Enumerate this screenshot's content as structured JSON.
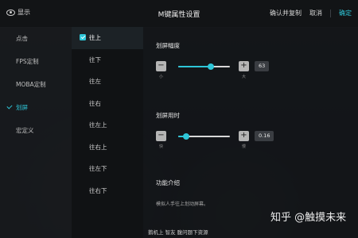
{
  "topbar": {
    "show_label": "显示",
    "title": "M键属性设置",
    "actions": {
      "confirm_copy": "确认并复制",
      "cancel": "取消",
      "ok": "确定"
    }
  },
  "left_nav": {
    "items": [
      {
        "label": "点击",
        "active": false
      },
      {
        "label": "FPS定制",
        "active": false
      },
      {
        "label": "MOBA定制",
        "active": false
      },
      {
        "label": "划屏",
        "active": true
      },
      {
        "label": "宏定义",
        "active": false
      }
    ]
  },
  "directions": {
    "items": [
      {
        "label": "往上",
        "active": true
      },
      {
        "label": "往下",
        "active": false
      },
      {
        "label": "往左",
        "active": false
      },
      {
        "label": "往右",
        "active": false
      },
      {
        "label": "往左上",
        "active": false
      },
      {
        "label": "往右上",
        "active": false
      },
      {
        "label": "往左下",
        "active": false
      },
      {
        "label": "往右下",
        "active": false
      }
    ]
  },
  "panel": {
    "swipe_amplitude": {
      "title": "划屏幅度",
      "min_label": "小",
      "max_label": "大",
      "value": "63",
      "fraction": 0.63
    },
    "swipe_time": {
      "title": "划屏用时",
      "min_label": "快",
      "max_label": "慢",
      "value": "0.16",
      "fraction": 0.16
    },
    "intro_title": "功能介绍",
    "description": "模拟人手往上划动屏幕。"
  },
  "watermark": "知乎 @触摸未来",
  "bottom_caption": "鹅机上 智友 腹问题下资源",
  "colors": {
    "accent": "#2ec6d8"
  }
}
